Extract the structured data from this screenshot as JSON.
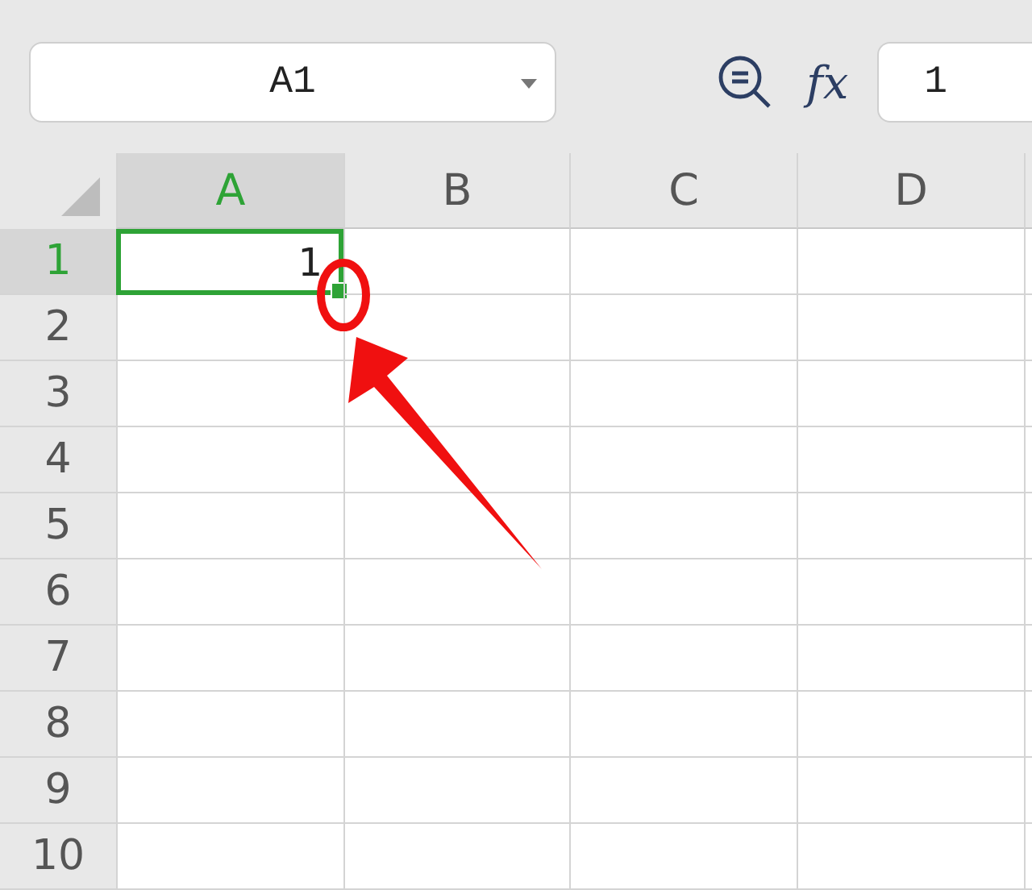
{
  "name_box": {
    "value": "A1"
  },
  "formula_bar": {
    "function_label": "fx",
    "value": "1"
  },
  "columns": [
    {
      "label": "A",
      "selected": true
    },
    {
      "label": "B",
      "selected": false
    },
    {
      "label": "C",
      "selected": false
    },
    {
      "label": "D",
      "selected": false
    }
  ],
  "rows": [
    {
      "label": "1",
      "selected": true,
      "cells": [
        {
          "value": "1",
          "selected": true
        }
      ]
    },
    {
      "label": "2",
      "selected": false
    },
    {
      "label": "3",
      "selected": false
    },
    {
      "label": "4",
      "selected": false
    },
    {
      "label": "5",
      "selected": false
    },
    {
      "label": "6",
      "selected": false
    },
    {
      "label": "7",
      "selected": false
    },
    {
      "label": "8",
      "selected": false
    },
    {
      "label": "9",
      "selected": false
    },
    {
      "label": "10",
      "selected": false
    }
  ]
}
